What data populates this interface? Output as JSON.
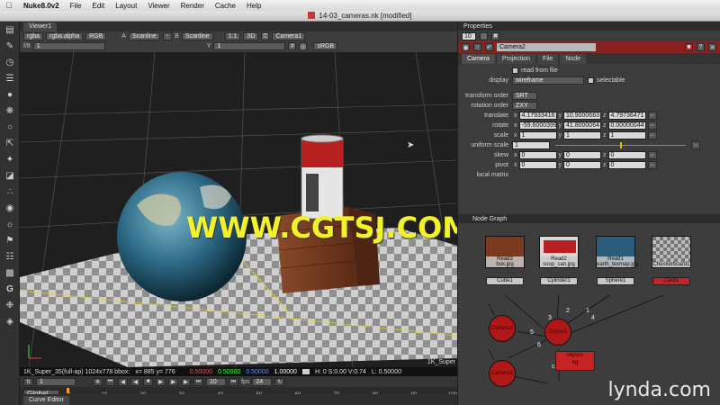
{
  "menubar": {
    "apple": "",
    "app_name": "Nuke8.0v2",
    "items": [
      "File",
      "Edit",
      "Layout",
      "Viewer",
      "Render",
      "Cache",
      "Help"
    ]
  },
  "window": {
    "title": "14-03_cameras.nk [modified]"
  },
  "viewer": {
    "tab_label": "Viewer1",
    "channels": "rgba",
    "alpha": "rgba.alpha",
    "colorspace_dd": "RGB",
    "a_label": "A",
    "a_input": "Scanline",
    "a_mode": "-",
    "b_label": "B",
    "b_input": "Scanline",
    "zoom": "1:1",
    "view_mode": "3D",
    "camera": "Camera1",
    "fstop_label": "f/8",
    "fstop_value": "1",
    "gamma_label": "Y",
    "gamma_value": "1",
    "lut": "sRGB",
    "format_tag": "1K_Super",
    "watermark": "WWW.CGTSJ.COM",
    "info": {
      "format": "1K_Super_35(full-ap) 1024x778 bbox:",
      "coords": "x= 885 y= 776",
      "r": "0.50000",
      "g": "0.50000",
      "b": "0.50000",
      "a": "1.00000",
      "hsv": "H: 0 S:0.00 V:0.74",
      "lum": "L: 0.50000"
    },
    "transport": {
      "frame": "1",
      "increment": "10",
      "fps_label": "fps",
      "fps": "24"
    },
    "timeline": {
      "scope": "Global",
      "ticks": [
        "1",
        "10",
        "20",
        "30",
        "40",
        "50",
        "60",
        "70",
        "80",
        "90",
        "100"
      ]
    }
  },
  "curve_editor": {
    "tab_label": "Curve Editor"
  },
  "properties": {
    "title": "Properties",
    "max_panels": "10",
    "node_name": "Camera2",
    "tabs": [
      "Camera",
      "Projection",
      "File",
      "Node"
    ],
    "read_from_file": "read from file",
    "display_label": "display",
    "display_value": "wireframe",
    "selectable": "selectable",
    "transform_order_label": "transform order",
    "transform_order": "SRT",
    "rotation_order_label": "rotation order",
    "rotation_order": "ZXY",
    "translate_label": "translate",
    "translate": {
      "x": "4.17933416",
      "y": "10.9000663",
      "z": "4.79736471"
    },
    "rotate_label": "rotate",
    "rotate": {
      "x": "-59.6000399",
      "y": "41.8000064",
      "z": "0.00000044"
    },
    "scale_label": "scale",
    "scale": {
      "x": "1",
      "y": "1",
      "z": "1"
    },
    "uniform_scale_label": "uniform scale",
    "uniform_scale": "1",
    "skew_label": "skew",
    "skew": {
      "x": "0",
      "y": "0",
      "z": "0"
    },
    "pivot_label": "pivot",
    "pivot": {
      "x": "0",
      "y": "0",
      "z": "0"
    },
    "local_matrix_label": "local matrix",
    "axes": {
      "x": "x",
      "y": "y",
      "z": "z"
    }
  },
  "node_graph": {
    "title": "Node Graph",
    "reads": [
      {
        "label": "Read3\nbox.jpg",
        "node": "Cube1"
      },
      {
        "label": "Read2\nsoup_can.jpg",
        "node": "Cylinder1"
      },
      {
        "label": "Read1\nearth_texmap.jpg",
        "node": "Sphere1"
      },
      {
        "label": "Checkerboard1",
        "node": "Card1"
      }
    ],
    "circles": [
      "Camera2",
      "Scene1",
      "Camera1"
    ],
    "edge_numbers": [
      "2",
      "3",
      "4",
      "1",
      "5",
      "6"
    ],
    "bottom_node": "obj/scn\nbg",
    "cam_label": "cam"
  },
  "brand": "lynda.com"
}
